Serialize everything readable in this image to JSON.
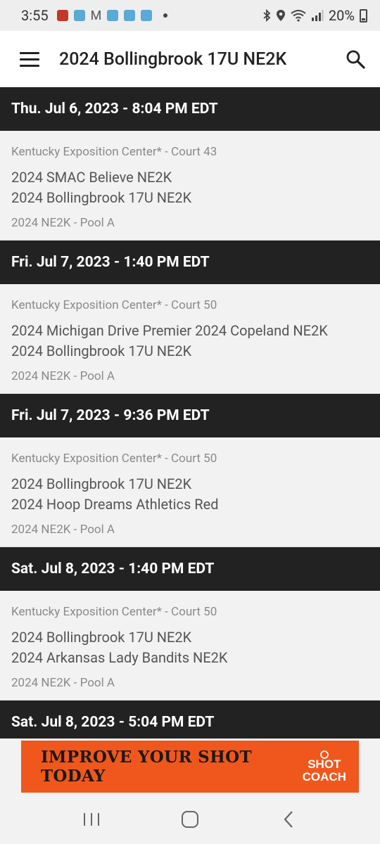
{
  "status_bar": {
    "time": "3:55",
    "battery": "20%",
    "icons": [
      "bluetooth-icon",
      "location-icon",
      "wifi-icon",
      "signal-icon",
      "battery-icon"
    ]
  },
  "app_bar": {
    "title": "2024 Bollingbrook 17U NE2K",
    "menu_icon": "hamburger-menu-icon",
    "search_icon": "search-icon"
  },
  "games": [
    {
      "date": "Thu. Jul 6, 2023 - 8:04 PM EDT",
      "venue": "Kentucky Exposition Center* - Court 43",
      "team1": "2024 SMAC Believe NE2K",
      "team2": "2024 Bollingbrook 17U NE2K",
      "pool": "2024 NE2K - Pool A"
    },
    {
      "date": "Fri. Jul 7, 2023 - 1:40 PM EDT",
      "venue": "Kentucky Exposition Center* - Court 50",
      "team1": "2024 Michigan Drive Premier 2024 Copeland NE2K",
      "team2": "2024 Bollingbrook 17U NE2K",
      "pool": "2024 NE2K - Pool A"
    },
    {
      "date": "Fri. Jul 7, 2023 - 9:36 PM EDT",
      "venue": "Kentucky Exposition Center* - Court 50",
      "team1": "2024 Bollingbrook 17U NE2K",
      "team2": "2024 Hoop Dreams Athletics Red",
      "pool": "2024 NE2K - Pool A"
    },
    {
      "date": "Sat. Jul 8, 2023 - 1:40 PM EDT",
      "venue": "Kentucky Exposition Center* - Court 50",
      "team1": "2024 Bollingbrook 17U NE2K",
      "team2": "2024 Arkansas Lady Bandits NE2K",
      "pool": "2024 NE2K - Pool A"
    },
    {
      "date": "Sat. Jul 8, 2023 - 5:04 PM EDT"
    }
  ],
  "ad": {
    "text": "IMPROVE YOUR SHOT TODAY",
    "logo_line1": "SHOT",
    "logo_line2": "COACH",
    "color": "#f0571d"
  },
  "nav_bar": {
    "icons": [
      "recent-apps-icon",
      "home-icon",
      "back-icon"
    ]
  },
  "colors": {
    "header_bg": "#222222",
    "card_bg": "#f2f2f2",
    "muted_text": "#8a8a8a",
    "team_text": "#555555"
  }
}
